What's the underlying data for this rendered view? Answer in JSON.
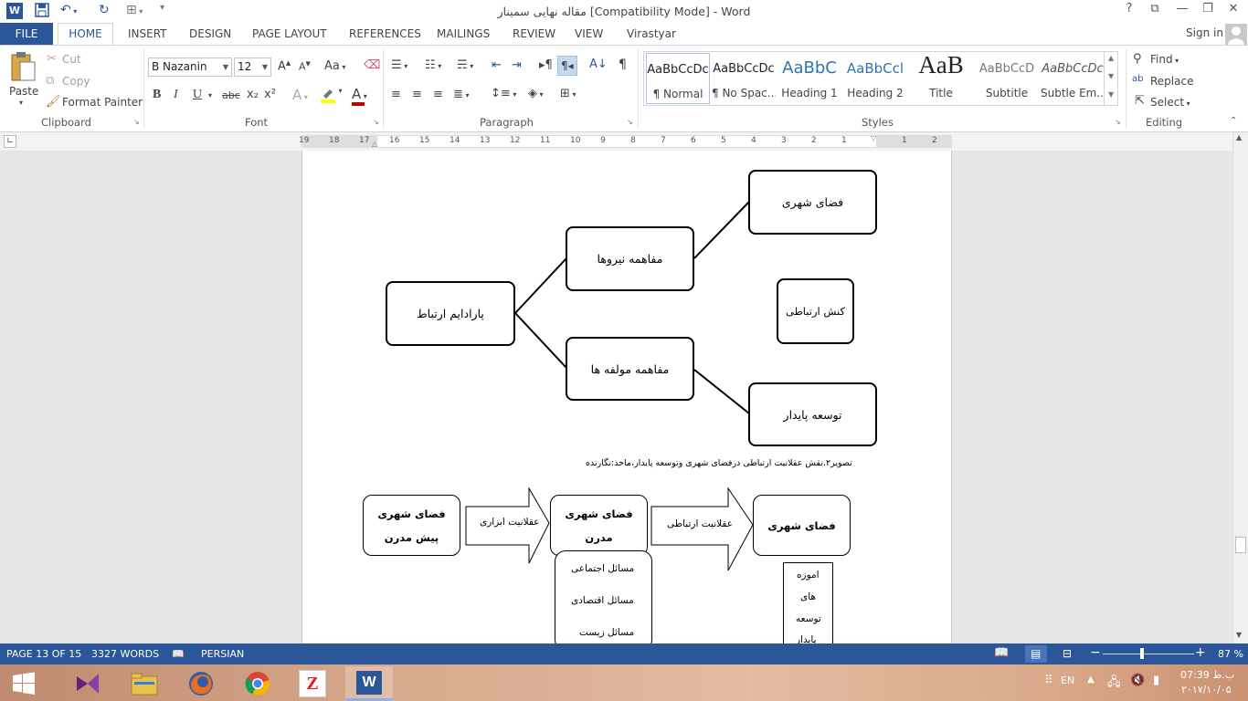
{
  "window": {
    "title": "مقاله نهایی سمینار [Compatibility Mode] - Word",
    "help": "?",
    "sign_in": "Sign in"
  },
  "tabs": [
    "FILE",
    "HOME",
    "INSERT",
    "DESIGN",
    "PAGE LAYOUT",
    "REFERENCES",
    "MAILINGS",
    "REVIEW",
    "VIEW",
    "Virastyar"
  ],
  "clipboard": {
    "paste": "Paste",
    "cut": "Cut",
    "copy": "Copy",
    "format_painter": "Format Painter",
    "label": "Clipboard"
  },
  "font": {
    "name": "B Nazanin",
    "size": "12",
    "label": "Font",
    "bold": "B",
    "italic": "I",
    "underline": "U",
    "strike": "abc",
    "subscript": "x₂",
    "superscript": "x²",
    "grow": "A",
    "shrink": "A",
    "case": "Aa",
    "effects": "A",
    "color_glyph": "A",
    "font_color": "#c00000",
    "highlight_color": "#ffff00"
  },
  "paragraph": {
    "label": "Paragraph",
    "pilcrow": "¶"
  },
  "styles": {
    "label": "Styles",
    "items": [
      {
        "preview": "AaBbCcDc",
        "name": "¶ Normal"
      },
      {
        "preview": "AaBbCcDc",
        "name": "¶ No Spac..."
      },
      {
        "preview": "AaBbC",
        "name": "Heading 1"
      },
      {
        "preview": "AaBbCcl",
        "name": "Heading 2"
      },
      {
        "preview": "AaB",
        "name": "Title"
      },
      {
        "preview": "AaBbCcD",
        "name": "Subtitle"
      },
      {
        "preview": "AaBbCcDc",
        "name": "Subtle Em..."
      }
    ]
  },
  "editing": {
    "find": "Find",
    "replace": "Replace",
    "select": "Select",
    "label": "Editing"
  },
  "ruler": {
    "numbers": [
      "19",
      "18",
      "17",
      "16",
      "15",
      "14",
      "13",
      "12",
      "11",
      "10",
      "9",
      "8",
      "7",
      "6",
      "5",
      "4",
      "3",
      "2",
      "1",
      "",
      "1",
      "2"
    ]
  },
  "diagram1": {
    "paradigm": "پارادایم ارتباط",
    "forces": "مفاهمه نیروها",
    "components": "مفاهمه مولفه ها",
    "urban_space": "فضای شهری",
    "comm_action": "کنش ارتباطی",
    "sustainable": "توسعه پایدار",
    "caption": "تصویر۲.نقش عقلانیت ارتباطی درفضای شهری وتوسعه پایدار،ماخذ:نگارنده"
  },
  "diagram2": {
    "premodern_1": "فضای شهری",
    "premodern_2": "پیش مدرن",
    "instrumental": "عقلانیت ابزاری",
    "modern_1": "فضای شهری",
    "modern_2": "مدرن",
    "communicative": "عقلانیت ارتباطی",
    "urban": "فضای شهری",
    "issues": [
      "مسائل اجتماعی",
      "مسائل اقتصادی",
      "مسائل زیست"
    ],
    "teachings": [
      "اموزه",
      "های",
      "توسعه",
      "پایدار"
    ]
  },
  "status": {
    "page": "PAGE 13 OF 15",
    "words": "3327 WORDS",
    "language": "PERSIAN",
    "zoom": "87 %",
    "zoom_minus": "−",
    "zoom_plus": "+",
    "zoom_level_percent": 87
  },
  "taskbar": {
    "lang": "EN",
    "time": "07:39 ب.ظ",
    "date": "۲۰۱۷/۱۰/۰۵"
  },
  "colors": {
    "accent": "#2b579a"
  }
}
